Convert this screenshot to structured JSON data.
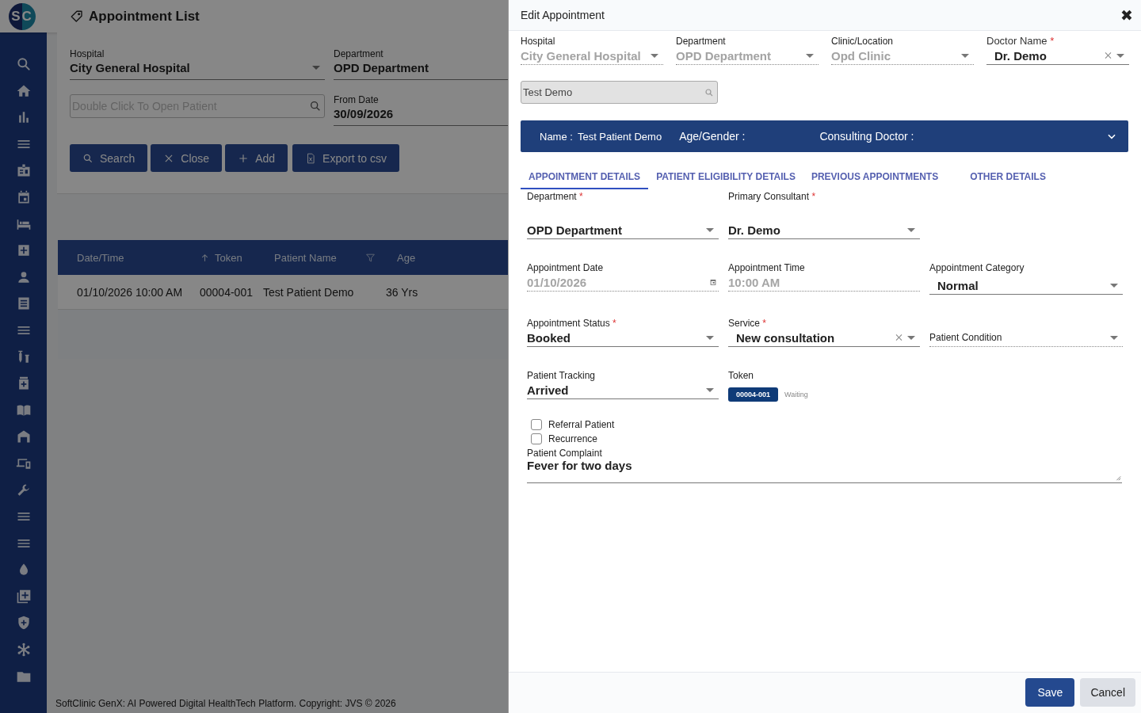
{
  "header": {
    "logo": "SC",
    "title": "Appointment List"
  },
  "filters": {
    "hospital": {
      "label": "Hospital",
      "value": "City General Hospital"
    },
    "department": {
      "label": "Department",
      "value": "OPD Department"
    },
    "patient_search": {
      "placeholder": "Double Click To Open Patient"
    },
    "from_date": {
      "label": "From Date",
      "value": "30/09/2026"
    }
  },
  "buttons": [
    {
      "label": "Search",
      "kind": "search"
    },
    {
      "label": "Close",
      "kind": "close"
    },
    {
      "label": "Add",
      "kind": "add"
    },
    {
      "label": "Export to csv",
      "kind": "export"
    }
  ],
  "table": {
    "columns": [
      {
        "label": "Date/Time",
        "kind": "plain"
      },
      {
        "label": "Token",
        "kind": "sort"
      },
      {
        "label": "Patient Name",
        "kind": "filter"
      },
      {
        "label": "Age",
        "kind": "plain"
      }
    ],
    "rows": [
      [
        "01/10/2026 10:00 AM",
        "00004-001",
        "Test Patient Demo",
        "36 Yrs"
      ]
    ]
  },
  "footer": "SoftClinic GenX: AI Powered Digital HealthTech Platform. Copyright: JVS © 2026",
  "dialog": {
    "title": "Edit Appointment",
    "close": "✖",
    "top_fields": [
      {
        "label": "Hospital",
        "value": "City General Hospital",
        "disabled": true,
        "clearable": false
      },
      {
        "label": "Department",
        "value": "OPD Department",
        "disabled": true,
        "clearable": false
      },
      {
        "label": "Clinic/Location",
        "value": "Opd Clinic",
        "disabled": true,
        "clearable": false
      },
      {
        "label": "Doctor Name",
        "required_mark": "*",
        "value": "Dr. Demo",
        "disabled": false,
        "clearable": true
      }
    ],
    "patient_search": {
      "value": "Test Demo"
    },
    "patient_banner": {
      "name_label": "Name :",
      "name": "Test Patient Demo",
      "age_gender_label": "Age/Gender :",
      "doctor_label": "Consulting Doctor :"
    },
    "tabs": [
      {
        "label": "APPOINTMENT DETAILS",
        "selected": true
      },
      {
        "label": "PATIENT ELIGIBILITY DETAILS",
        "selected": false
      },
      {
        "label": "PREVIOUS APPOINTMENTS",
        "selected": false
      },
      {
        "label": "OTHER DETAILS",
        "selected": false
      }
    ],
    "field_rows": [
      [
        {
          "kind": "select",
          "label": "Department",
          "required_mark": "*",
          "value": "OPD Department",
          "disabled": false,
          "clearable": false
        },
        {
          "kind": "select",
          "label": "Primary Consultant",
          "required_mark": "*",
          "value": "Dr. Demo",
          "disabled": false,
          "clearable": false
        }
      ],
      [
        {
          "kind": "date",
          "label": "Appointment Date",
          "value": "01/10/2026",
          "disabled": true,
          "clearable": false
        },
        {
          "kind": "time",
          "label": "Appointment Time",
          "value": "10:00 AM",
          "disabled": true,
          "clearable": false
        },
        {
          "kind": "select",
          "label": "Appointment Category",
          "value": "Normal",
          "disabled": false,
          "clearable": false
        }
      ],
      [
        {
          "kind": "select",
          "label": "Appointment Status",
          "required_mark": "*",
          "value": "Booked",
          "disabled": false,
          "clearable": false
        },
        {
          "kind": "select",
          "label": "Service",
          "required_mark": "*",
          "value": "New consultation",
          "disabled": false,
          "clearable": true
        },
        {
          "kind": "select",
          "label": "Patient Condition",
          "disabled": true,
          "clearable": false
        }
      ],
      [
        {
          "kind": "select",
          "label": "Patient Tracking",
          "value": "Arrived",
          "disabled": false,
          "clearable": false
        },
        {
          "kind": "token",
          "label": "Token",
          "value": "00004-001",
          "status": "Waiting"
        }
      ]
    ],
    "checkboxes": [
      {
        "label": "Referral Patient",
        "checked": false
      },
      {
        "label": "Recurrence",
        "checked": false
      }
    ],
    "complaint": {
      "label": "Patient Complaint",
      "value": "Fever for two days"
    },
    "buttons": [
      {
        "label": "Save",
        "kind": "primary"
      },
      {
        "label": "Cancel",
        "kind": "secondary"
      }
    ]
  }
}
